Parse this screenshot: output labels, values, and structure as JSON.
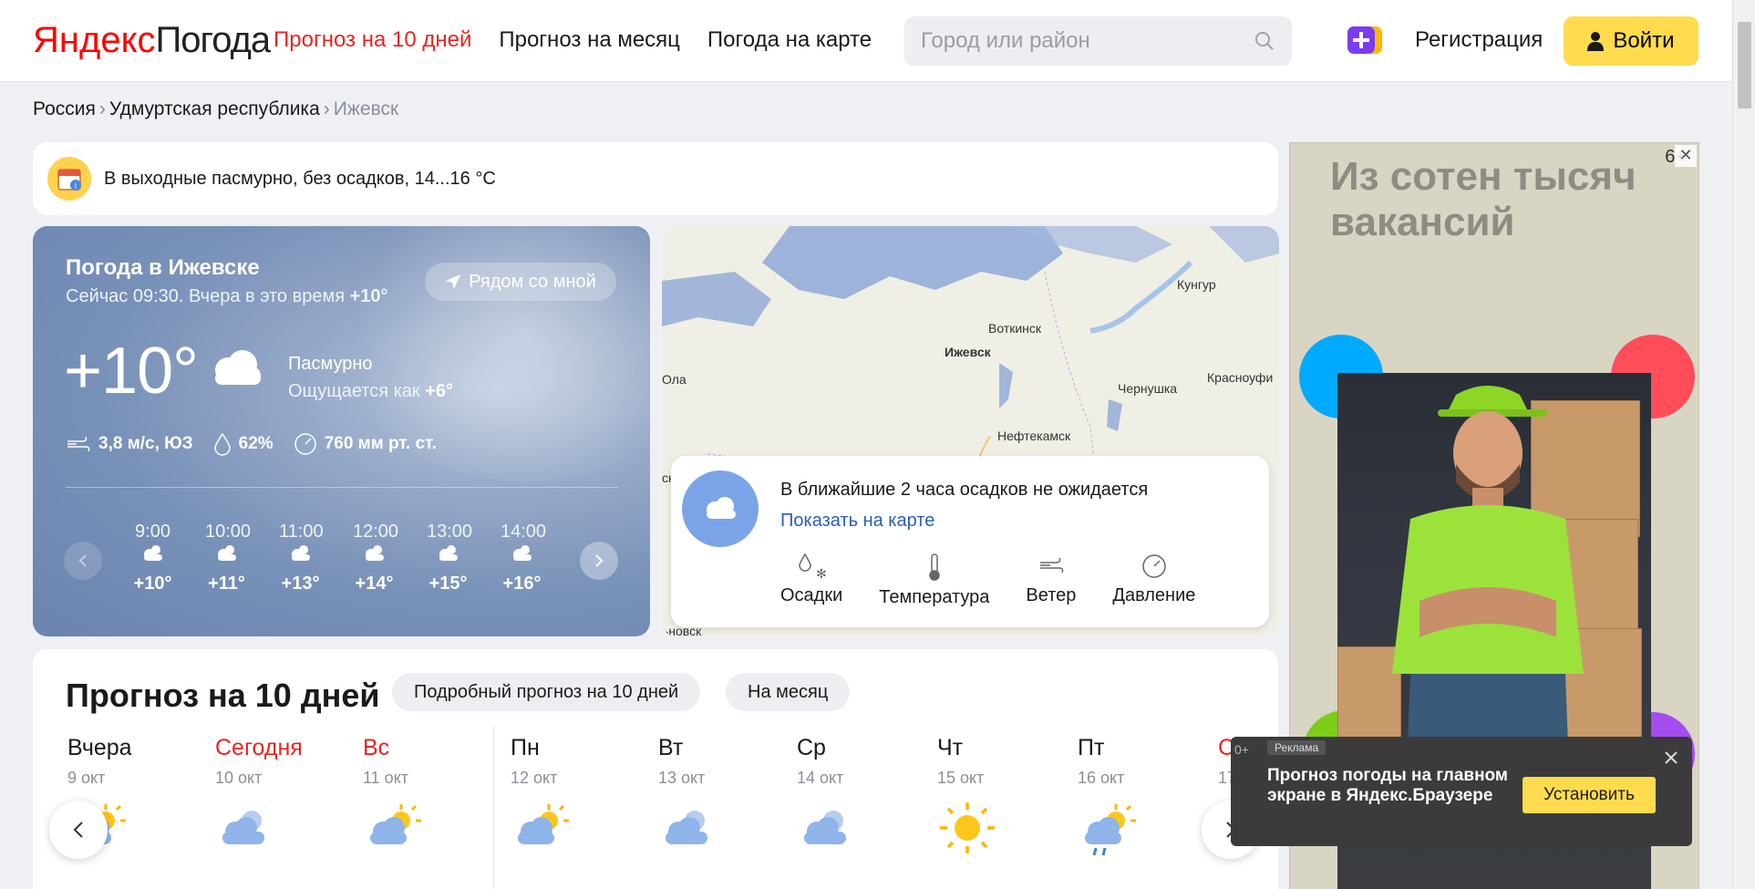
{
  "header": {
    "logo_yandex": "Яндекс",
    "logo_pogoda": "Погода",
    "nav": [
      "Прогноз на 10 дней",
      "Прогноз на месяц",
      "Погода на карте"
    ],
    "search_placeholder": "Город или район",
    "register": "Регистрация",
    "login": "Войти"
  },
  "breadcrumb": [
    "Россия",
    "Удмуртская республика",
    "Ижевск"
  ],
  "alert": "В выходные пасмурно, без осадков, 14...16 °C",
  "now": {
    "title": "Погода в Ижевске",
    "subtitle": "Сейчас 09:30. Вчера в это время",
    "yesterday_temp": "+10°",
    "near_me": "Рядом со мной",
    "temp": "+10°",
    "condition": "Пасмурно",
    "feels_label": "Ощущается как",
    "feels_value": "+6°",
    "wind": "3,8 м/с, ЮЗ",
    "humidity": "62%",
    "pressure": "760 мм рт. ст.",
    "hours": [
      {
        "time": "9:00",
        "temp": "+10°"
      },
      {
        "time": "10:00",
        "temp": "+11°"
      },
      {
        "time": "11:00",
        "temp": "+13°"
      },
      {
        "time": "12:00",
        "temp": "+14°"
      },
      {
        "time": "13:00",
        "temp": "+15°"
      },
      {
        "time": "14:00",
        "temp": "+16°"
      }
    ]
  },
  "map": {
    "places": [
      "Кунгур",
      "Воткинск",
      "Ижевск",
      "Ола",
      "Чернушка",
      "Красноуфи",
      "Нефтекамск",
      "ск",
      "ьновск"
    ],
    "message": "В ближайшие 2 часа осадков не ожидается",
    "link": "Показать на карте",
    "layers": [
      "Осадки",
      "Температура",
      "Ветер",
      "Давление"
    ]
  },
  "forecast": {
    "title": "Прогноз на 10 дней",
    "detailed_button": "Подробный прогноз на 10 дней",
    "month_button": "На месяц",
    "days": [
      {
        "name": "Вчера",
        "date": "9 окт",
        "icon": "sun-cloud-icon",
        "red": false
      },
      {
        "name": "Сегодня",
        "date": "10 окт",
        "icon": "cloud-icon",
        "red": true
      },
      {
        "name": "Вс",
        "date": "11 окт",
        "icon": "sun-cloud-icon",
        "red": true
      },
      {
        "name": "Пн",
        "date": "12 окт",
        "icon": "sun-cloud-icon",
        "red": false
      },
      {
        "name": "Вт",
        "date": "13 окт",
        "icon": "cloud-icon",
        "red": false
      },
      {
        "name": "Ср",
        "date": "14 окт",
        "icon": "cloud-icon",
        "red": false
      },
      {
        "name": "Чт",
        "date": "15 окт",
        "icon": "sun-icon",
        "red": false
      },
      {
        "name": "Пт",
        "date": "16 окт",
        "icon": "sun-cloud-rain-icon",
        "red": false
      },
      {
        "name": "С",
        "date": "17",
        "icon": "",
        "red": true
      }
    ]
  },
  "ad": {
    "headline": "Из сотен тысяч вакансий",
    "badge": "6+"
  },
  "toast": {
    "age": "0+",
    "tag": "Реклама",
    "message": "Прогноз погоды на главном экране в Яндекс.Браузере",
    "install": "Установить"
  },
  "colors": {
    "accent_red": "#e52620",
    "yellow": "#ffdb4d",
    "link_blue": "#2b5fb4"
  }
}
